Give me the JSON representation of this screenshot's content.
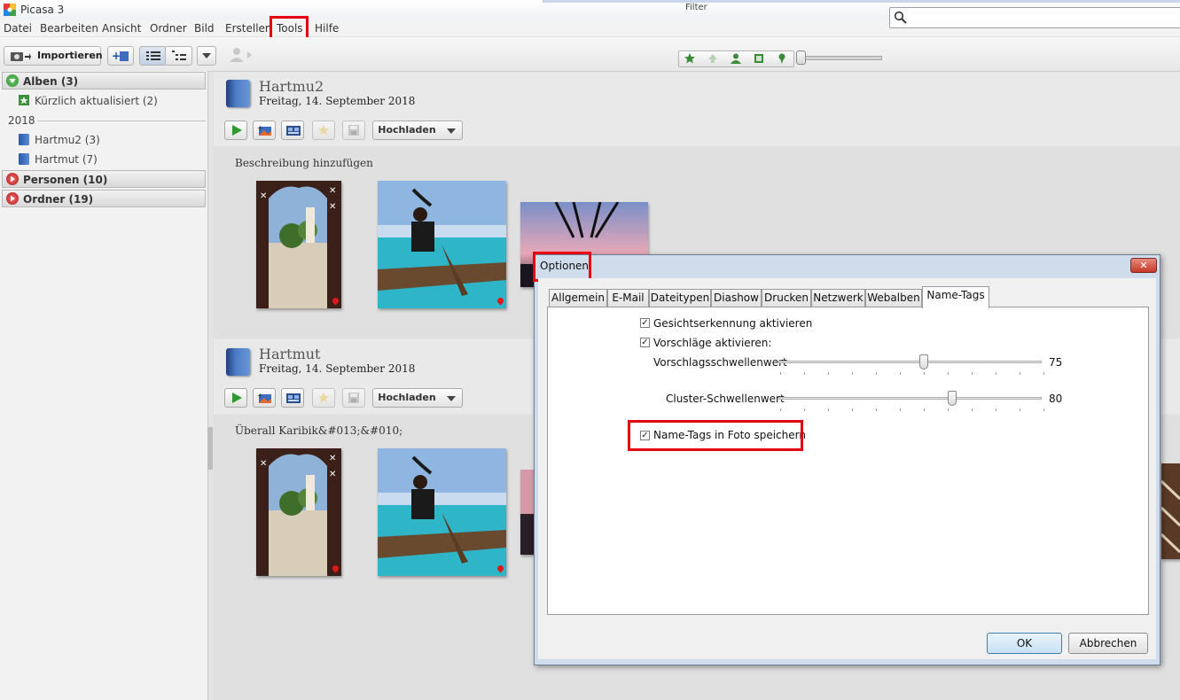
{
  "app": {
    "title": "Picasa 3"
  },
  "menu": [
    "Datei",
    "Bearbeiten",
    "Ansicht",
    "Ordner",
    "Bild",
    "Erstellen",
    "Tools",
    "Hilfe"
  ],
  "toolbar": {
    "import_label": "Importieren",
    "filter_label": "Filter"
  },
  "sidebar": {
    "albums_header": "Alben (3)",
    "recent": "Kürzlich aktualisiert (2)",
    "year": "2018",
    "items": [
      "Hartmu2 (3)",
      "Hartmut (7)"
    ],
    "people_header": "Personen (10)",
    "folders_header": "Ordner (19)"
  },
  "albums": [
    {
      "title": "Hartmu2",
      "date": "Freitag, 14. September 2018",
      "upload_label": "Hochladen",
      "description": "Beschreibung hinzufügen"
    },
    {
      "title": "Hartmut",
      "date": "Freitag, 14. September 2018",
      "upload_label": "Hochladen",
      "description": "Überall Karibik&#013;&#010;"
    }
  ],
  "dialog": {
    "title": "Optionen",
    "close": "✕",
    "tabs": [
      "Allgemein",
      "E-Mail",
      "Dateitypen",
      "Diashow",
      "Drucken",
      "Netzwerk",
      "Webalben",
      "Name-Tags"
    ],
    "active_tab": "Name-Tags",
    "options": {
      "face_detection": "Gesichtserkennung aktivieren",
      "suggestions": "Vorschläge aktivieren:",
      "suggest_threshold_label": "Vorschlagsschwellenwert",
      "suggest_threshold_value": "75",
      "cluster_threshold_label": "Cluster-Schwellenwert",
      "cluster_threshold_value": "80",
      "save_tags": "Name-Tags in Foto speichern"
    },
    "ok": "OK",
    "cancel": "Abbrechen"
  },
  "colors": {
    "highlight": "#e4000f",
    "accent": "#2a5aa8"
  }
}
